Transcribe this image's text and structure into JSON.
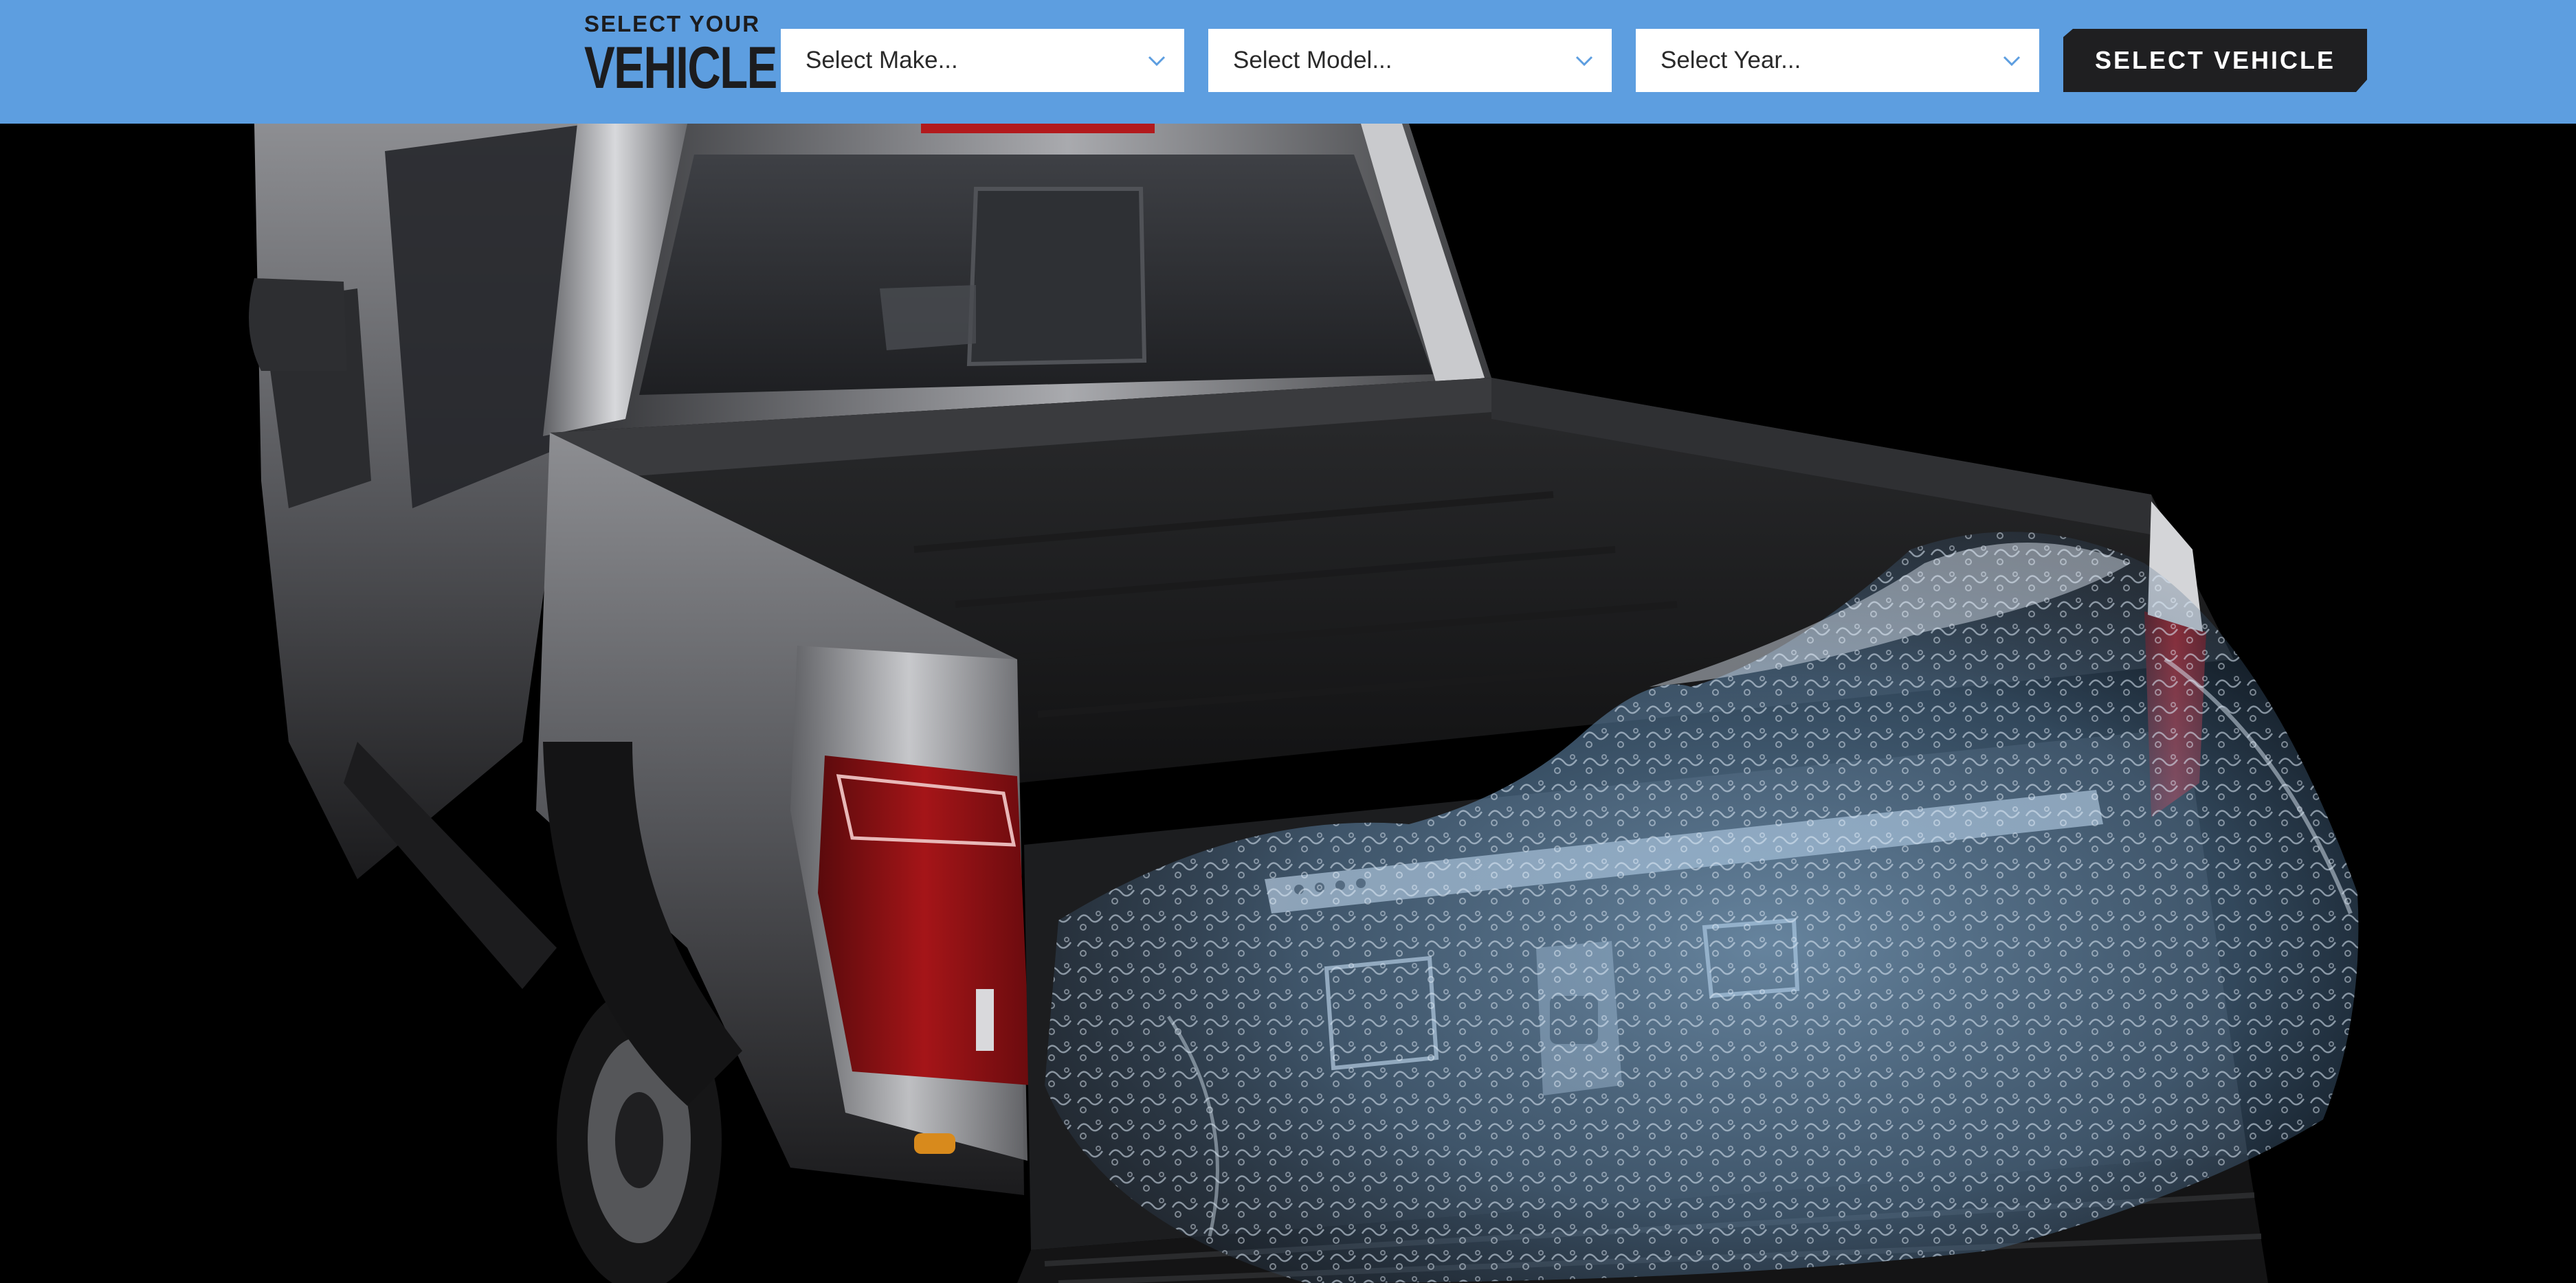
{
  "vehicle_selector": {
    "heading_line1": "SELECT YOUR",
    "heading_line2": "VEHICLE",
    "make": {
      "value": "Select Make..."
    },
    "model": {
      "value": "Select Model..."
    },
    "year": {
      "value": "Select Year..."
    },
    "submit_label": "SELECT VEHICLE",
    "icons": {
      "dropdown": "chevron-down-icon"
    }
  },
  "hero": {
    "image_alt": "Pickup truck bed with drawer storage system being washed by water"
  },
  "colors": {
    "bar_background": "#5d9ee0",
    "heading_text": "#1c1c1e",
    "button_background": "#1f1f21",
    "button_text": "#ffffff",
    "select_background": "#ffffff",
    "hero_background": "#000000"
  }
}
